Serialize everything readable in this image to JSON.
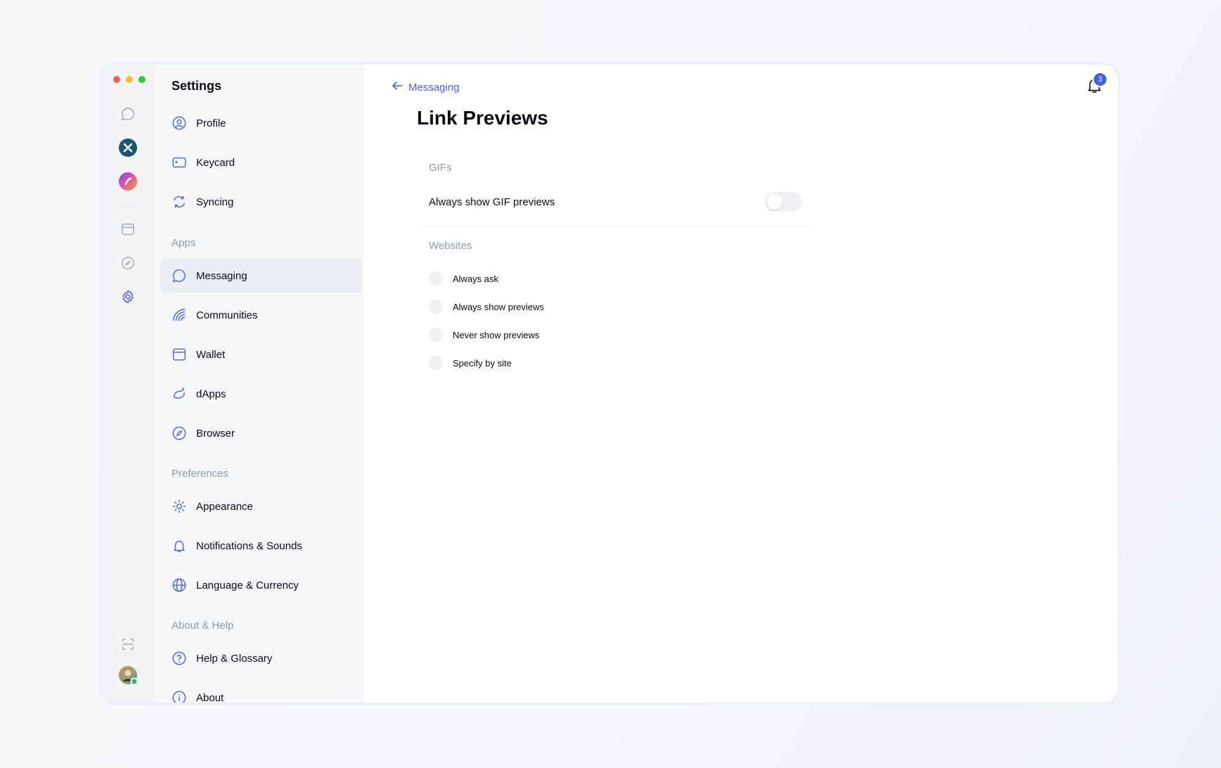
{
  "rail": {
    "icons": [
      "chat-icon",
      "app-x-icon",
      "app-gradient-icon",
      "wallet-icon",
      "compass-icon",
      "settings-gear-icon",
      "scan-icon",
      "user-avatar"
    ]
  },
  "sidebar": {
    "title": "Settings",
    "account": [
      {
        "label": "Profile",
        "icon": "profile-icon"
      },
      {
        "label": "Keycard",
        "icon": "keycard-icon"
      },
      {
        "label": "Syncing",
        "icon": "syncing-icon"
      }
    ],
    "apps_label": "Apps",
    "apps": [
      {
        "label": "Messaging",
        "icon": "messaging-icon",
        "active": true
      },
      {
        "label": "Communities",
        "icon": "communities-icon"
      },
      {
        "label": "Wallet",
        "icon": "wallet-icon"
      },
      {
        "label": "dApps",
        "icon": "dapps-icon"
      },
      {
        "label": "Browser",
        "icon": "browser-icon"
      }
    ],
    "preferences_label": "Preferences",
    "preferences": [
      {
        "label": "Appearance",
        "icon": "appearance-icon"
      },
      {
        "label": "Notifications & Sounds",
        "icon": "bell-icon"
      },
      {
        "label": "Language & Currency",
        "icon": "globe-icon"
      }
    ],
    "about_label": "About & Help",
    "about": [
      {
        "label": "Help & Glossary",
        "icon": "help-icon"
      },
      {
        "label": "About",
        "icon": "info-icon"
      }
    ]
  },
  "main": {
    "back_label": "Messaging",
    "notification_count": "3",
    "title": "Link Previews",
    "gifs": {
      "label": "GIFs",
      "toggle_label": "Always show GIF previews",
      "toggle_on": false
    },
    "websites": {
      "label": "Websites",
      "options": [
        "Always ask",
        "Always show previews",
        "Never show previews",
        "Specify by site"
      ]
    }
  },
  "colors": {
    "accent": "#4360df",
    "muted": "#939ba1",
    "text": "#0b0b12"
  }
}
